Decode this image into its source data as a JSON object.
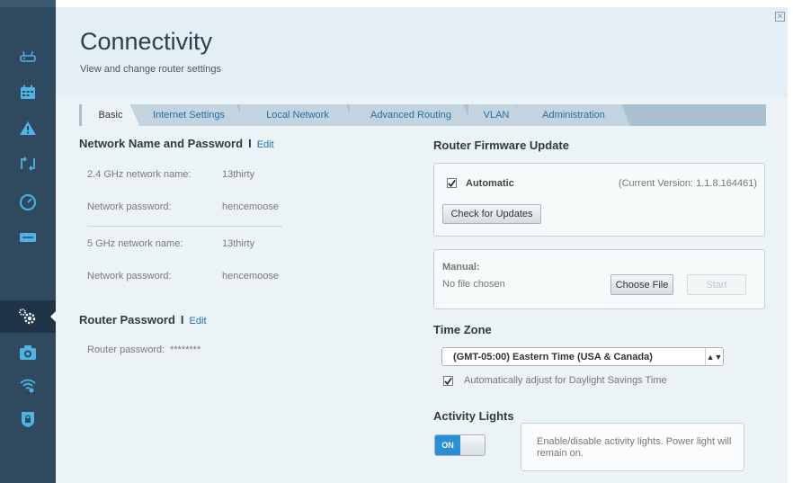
{
  "window": {
    "close_glyph": "✕"
  },
  "sidebar": {
    "items": [
      {
        "icon": "router-icon"
      },
      {
        "icon": "calendar-icon"
      },
      {
        "icon": "warning-icon"
      },
      {
        "icon": "connect-icon"
      },
      {
        "icon": "speedometer-icon"
      },
      {
        "icon": "external-storage-icon"
      },
      {
        "icon": "gear-icon"
      },
      {
        "icon": "camera-icon"
      },
      {
        "icon": "wifi-icon"
      },
      {
        "icon": "lock-icon"
      }
    ],
    "active_index": 6
  },
  "header": {
    "title": "Connectivity",
    "subtitle": "View and change router settings"
  },
  "tabs": [
    {
      "label": "Basic",
      "active": true
    },
    {
      "label": "Internet Settings",
      "active": false
    },
    {
      "label": "Local Network",
      "active": false
    },
    {
      "label": "Advanced Routing",
      "active": false
    },
    {
      "label": "VLAN",
      "active": false
    },
    {
      "label": "Administration",
      "active": false
    }
  ],
  "network": {
    "title": "Network Name and Password",
    "edit": "Edit",
    "rows": [
      {
        "label": "2.4 GHz network name:",
        "value": "13thirty"
      },
      {
        "label": "Network password:",
        "value": "hencemoose"
      },
      {
        "label": "5 GHz network name:",
        "value": "13thirty"
      },
      {
        "label": "Network password:",
        "value": "hencemoose"
      }
    ]
  },
  "router_password": {
    "title": "Router Password",
    "edit": "Edit",
    "label": "Router password:",
    "value": "********"
  },
  "firmware": {
    "title": "Router Firmware Update",
    "automatic_label": "Automatic",
    "automatic_checked": true,
    "current_version": "(Current Version: 1.1.8.164461)",
    "check_button": "Check for Updates",
    "manual_label": "Manual:",
    "no_file": "No file chosen",
    "choose_button": "Choose File",
    "start_button": "Start"
  },
  "timezone": {
    "title": "Time Zone",
    "selected": "(GMT-05:00) Eastern Time (USA & Canada)",
    "dst_label": "Automatically adjust for Daylight Savings Time",
    "dst_checked": true
  },
  "activity": {
    "title": "Activity Lights",
    "toggle_label": "ON",
    "description": "Enable/disable activity lights. Power light will remain on."
  },
  "colors": {
    "sidebar": "#2f4a5f",
    "accent": "#2a8fd4",
    "link": "#1d6fa8"
  }
}
